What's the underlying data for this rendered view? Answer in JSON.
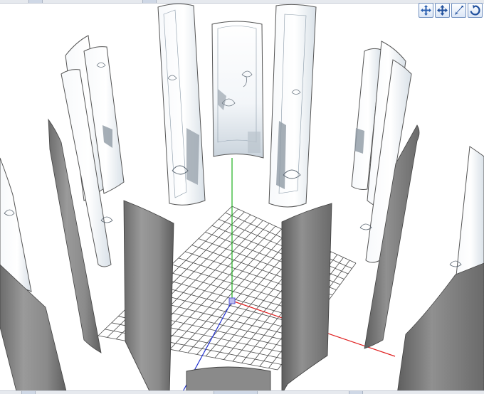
{
  "window": {
    "kind": "3d-viewport"
  },
  "toolbar": {
    "buttons": [
      {
        "name": "pan-camera-button",
        "icon": "move-arrows-icon",
        "tooltip": ""
      },
      {
        "name": "move-camera-button",
        "icon": "four-way-arrows-icon",
        "tooltip": ""
      },
      {
        "name": "zoom-camera-button",
        "icon": "diagonal-arrow-icon",
        "tooltip": ""
      },
      {
        "name": "rotate-camera-button",
        "icon": "rotate-arrow-icon",
        "tooltip": ""
      }
    ]
  },
  "scene": {
    "ground_grid": {
      "cells": 20
    },
    "axes": {
      "x_color": "#e02020",
      "y_color": "#20b020",
      "z_color": "#2030d0",
      "origin_marker_color": "#5a5ad0"
    },
    "panel_colors": {
      "back_face": "#7f7f7f",
      "back_face_light": "#b8b8b8",
      "front_face_light": "#ffffff",
      "front_face_tint": "#dfe6ec",
      "outline": "#555555"
    },
    "print_motif": "butterfly-print"
  }
}
